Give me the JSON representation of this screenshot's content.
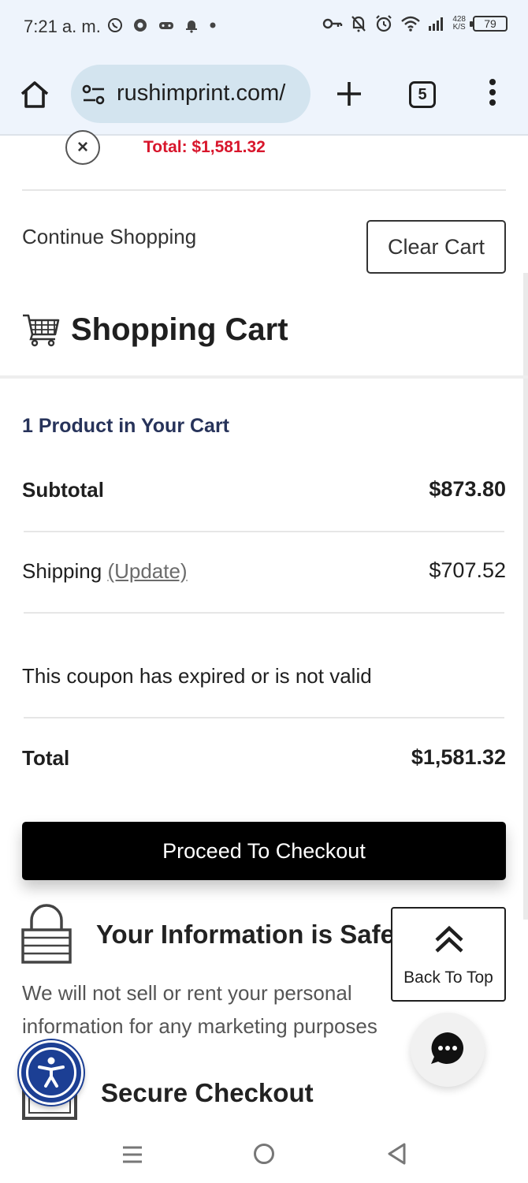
{
  "status_bar": {
    "time": "7:21 a. m.",
    "left_icons": [
      "whatsapp-icon",
      "chrome-icon",
      "game-icon",
      "notification-bell-icon",
      "dot-icon"
    ],
    "right_icons": [
      "key-icon",
      "bell-off-icon",
      "alarm-icon",
      "wifi-icon",
      "signal-icon"
    ],
    "net_speed_value": "428",
    "net_speed_unit": "K/S",
    "battery": "79"
  },
  "browser": {
    "url": "rushimprint.com/",
    "tab_count": "5"
  },
  "mini_cart": {
    "total_text": "Total: $1,581.32",
    "close_glyph": "×"
  },
  "actions": {
    "continue_shopping": "Continue Shopping",
    "clear_cart": "Clear Cart"
  },
  "cart": {
    "heading": "Shopping Cart",
    "product_count": "1 Product in Your Cart",
    "subtotal_label": "Subtotal",
    "subtotal_value": "$873.80",
    "shipping_label": "Shipping",
    "shipping_update": "(Update)",
    "shipping_value": "$707.52",
    "coupon_message": "This coupon has expired or is not valid",
    "total_label": "Total",
    "total_value": "$1,581.32",
    "checkout_button": "Proceed To Checkout"
  },
  "trust": {
    "safe_title": "Your Information is Safe",
    "safe_text": "We will not sell or rent your personal information for any marketing purposes",
    "secure_title": "Secure Checkout"
  },
  "floating": {
    "back_to_top": "Back To Top",
    "chat_icon": "chat-bubble-icon",
    "accessibility_icon": "accessibility-icon"
  },
  "colors": {
    "mini_total_red": "#d8162c",
    "product_count_navy": "#27335a",
    "checkout_black": "#000000",
    "accessibility_blue": "#1c3f94",
    "browser_bar_bg": "#eef4fc",
    "url_pill_bg": "#d3e4ef"
  }
}
